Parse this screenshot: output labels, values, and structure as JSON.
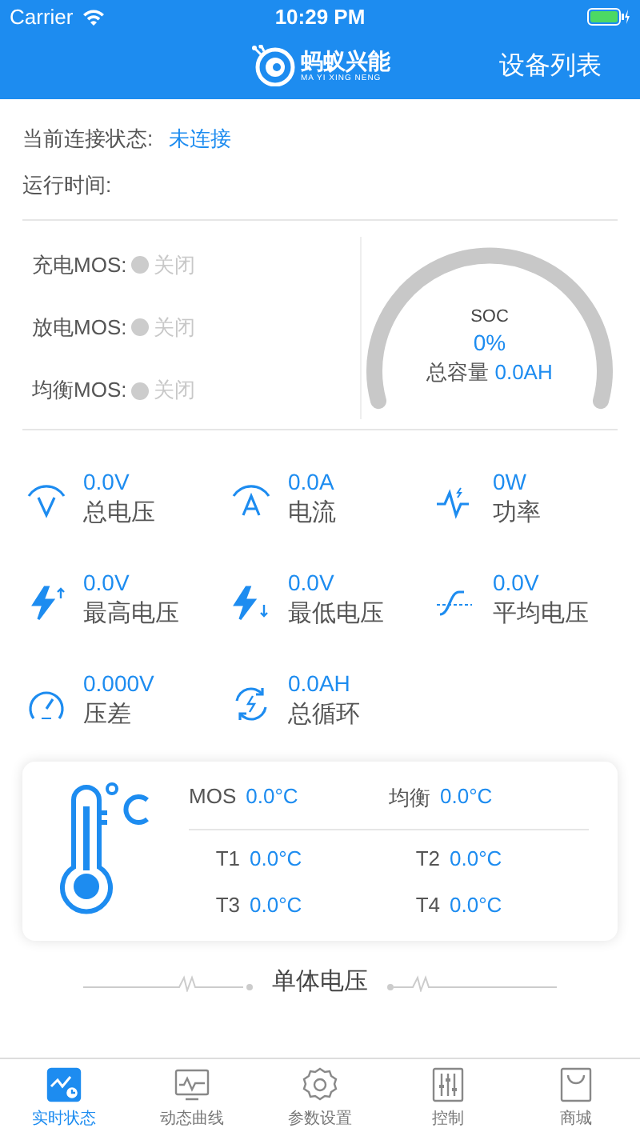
{
  "status_bar": {
    "carrier": "Carrier",
    "time": "10:29 PM"
  },
  "nav": {
    "logo_name": "蚂蚁兴能",
    "logo_pinyin": "MA YI XING NENG",
    "right_button": "设备列表"
  },
  "connection": {
    "label": "当前连接状态:",
    "value": "未连接",
    "runtime_label": "运行时间:"
  },
  "mos": [
    {
      "label": "充电MOS:",
      "status": "关闭",
      "on": false
    },
    {
      "label": "放电MOS:",
      "status": "关闭",
      "on": false
    },
    {
      "label": "均衡MOS:",
      "status": "关闭",
      "on": false
    }
  ],
  "soc": {
    "label": "SOC",
    "value": "0%",
    "capacity_label": "总容量",
    "capacity_value": "0.0AH"
  },
  "metrics": [
    {
      "value": "0.0V",
      "label": "总电压"
    },
    {
      "value": "0.0A",
      "label": "电流"
    },
    {
      "value": "0W",
      "label": "功率"
    },
    {
      "value": "0.0V",
      "label": "最高电压"
    },
    {
      "value": "0.0V",
      "label": "最低电压"
    },
    {
      "value": "0.0V",
      "label": "平均电压"
    },
    {
      "value": "0.000V",
      "label": "压差"
    },
    {
      "value": "0.0AH",
      "label": "总循环"
    }
  ],
  "temperature": {
    "top": [
      {
        "label": "MOS",
        "value": "0.0°C"
      },
      {
        "label": "均衡",
        "value": "0.0°C"
      }
    ],
    "sensors": [
      {
        "label": "T1",
        "value": "0.0°C"
      },
      {
        "label": "T2",
        "value": "0.0°C"
      },
      {
        "label": "T3",
        "value": "0.0°C"
      },
      {
        "label": "T4",
        "value": "0.0°C"
      }
    ]
  },
  "cell_voltage_heading": "单体电压",
  "tabs": [
    {
      "label": "实时状态",
      "selected": true
    },
    {
      "label": "动态曲线",
      "selected": false
    },
    {
      "label": "参数设置",
      "selected": false
    },
    {
      "label": "控制",
      "selected": false
    },
    {
      "label": "商城",
      "selected": false
    }
  ]
}
